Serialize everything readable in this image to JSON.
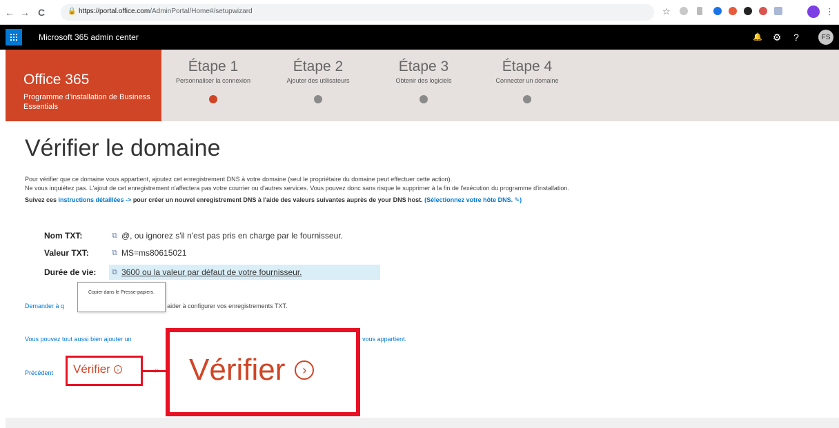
{
  "browser": {
    "back": "←",
    "forward": "→",
    "reload": "C",
    "lock": "🔒",
    "url_host": "https://portal.office.com",
    "url_path": "/AdminPortal/Home#/setupwizard",
    "star": "☆",
    "menu": "⋮"
  },
  "topbar": {
    "app_title": "Microsoft 365 admin center",
    "bell": "🔔",
    "gear": "⚙",
    "help": "?",
    "avatar": "FS"
  },
  "wizard": {
    "brand_title": "Office 365",
    "brand_subtitle": "Programme d'installation de Business Essentials",
    "steps": [
      {
        "title": "Étape 1",
        "subtitle": "Personnaliser la connexion",
        "active": true
      },
      {
        "title": "Étape 2",
        "subtitle": "Ajouter des utilisateurs",
        "active": false
      },
      {
        "title": "Étape 3",
        "subtitle": "Obtenir des logiciels",
        "active": false
      },
      {
        "title": "Étape 4",
        "subtitle": "Connecter un domaine",
        "active": false
      }
    ]
  },
  "main": {
    "title": "Vérifier le domaine",
    "intro_line1": "Pour vérifier que ce domaine vous appartient, ajoutez cet enregistrement DNS à votre domaine (seul le propriétaire du domaine peut effectuer cette action).",
    "intro_line2": "Ne vous inquiétez pas. L'ajout de cet enregistrement n'affectera pas votre courrier ou d'autres services. Vous pouvez donc sans risque le supprimer à la fin de l'exécution du programme d'installation.",
    "intro_line3_prefix": "Suivez ces ",
    "intro_line3_link": "instructions détaillées ->",
    "intro_line3_middle": " pour créer un nouvel enregistrement DNS à l'aide des valeurs suivantes auprès de your DNS host.",
    "intro_line3_link2": " (Sélectionnez votre hôte DNS. ✎)",
    "fields": [
      {
        "label": "Nom TXT:",
        "value": "@, ou ignorez s'il n'est pas pris en charge par le fournisseur."
      },
      {
        "label": "Valeur TXT:",
        "value": "MS=ms80615021"
      },
      {
        "label": "Durée de vie:",
        "value": "3600 ou la valeur par défaut de votre fournisseur."
      }
    ],
    "copy_icon": "⧉",
    "tooltip": "Copier dans le Presse-papiers.",
    "help_prefix": "Demander à q",
    "help_suffix": "issez-nous vous aider à configurer vos enregistrements TXT.",
    "alt_prefix": "Vous pouvez tout aussi bien ajouter un",
    "alt_suffix": "e vous appartient.",
    "prev": "Précédent",
    "verify": "Vérifier",
    "verify_arrow": "›",
    "behind": "P"
  }
}
